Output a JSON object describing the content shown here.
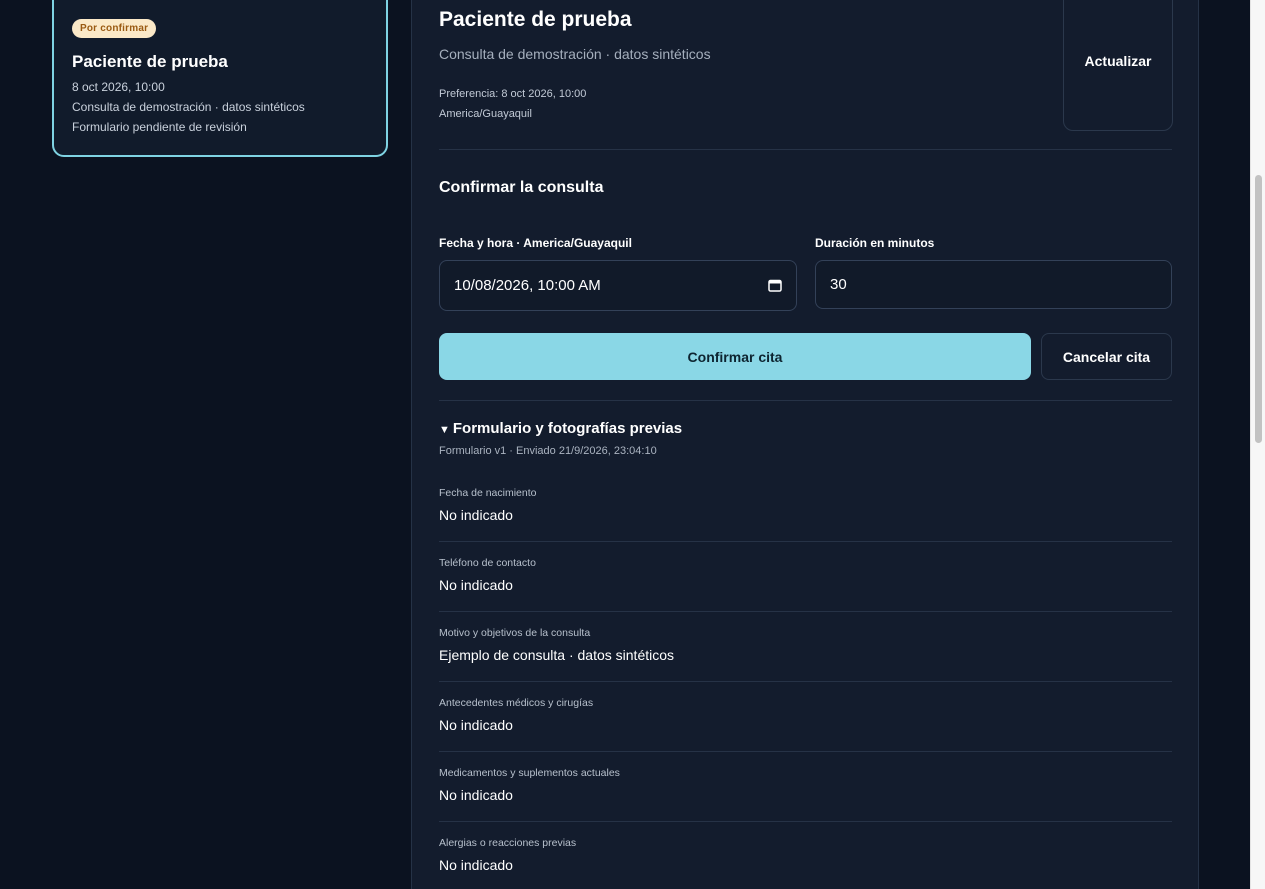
{
  "sidebar_card": {
    "badge": "Por confirmar",
    "name": "Paciente de prueba",
    "datetime": "8 oct 2026, 10:00",
    "service": "Consulta de demostración · datos sintéticos",
    "form_status": "Formulario pendiente de revisión"
  },
  "detail": {
    "patient_name": "Paciente de prueba",
    "service": "Consulta de demostración · datos sintéticos",
    "preference": "Preferencia: 8 oct 2026, 10:00",
    "timezone": "America/Guayaquil",
    "refresh_label": "Actualizar"
  },
  "confirm": {
    "heading": "Confirmar la consulta",
    "datetime_label": "Fecha y hora · America/Guayaquil",
    "datetime_value": "10/08/2026, 10:00 AM",
    "duration_label": "Duración en minutos",
    "duration_value": "30",
    "confirm_label": "Confirmar cita",
    "cancel_label": "Cancelar cita"
  },
  "intake": {
    "summary_marker": "▼",
    "summary_title": "Formulario y fotografías previas",
    "meta": "Formulario v1 · Enviado 21/9/2026, 23:04:10",
    "fields": [
      {
        "question": "Fecha de nacimiento",
        "answer": "No indicado"
      },
      {
        "question": "Teléfono de contacto",
        "answer": "No indicado"
      },
      {
        "question": "Motivo y objetivos de la consulta",
        "answer": "Ejemplo de consulta · datos sintéticos"
      },
      {
        "question": "Antecedentes médicos y cirugías",
        "answer": "No indicado"
      },
      {
        "question": "Medicamentos y suplementos actuales",
        "answer": "No indicado"
      },
      {
        "question": "Alergias o reacciones previas",
        "answer": "No indicado"
      }
    ]
  },
  "colors": {
    "background": "#0b1220",
    "panel": "#131c2d",
    "accent": "#8ad7e6",
    "badge_bg": "#fbe9c8",
    "badge_text": "#9a5a12"
  },
  "icons": {
    "datetime_picker": "calendar-icon",
    "summary_toggle": "triangle-down-icon"
  }
}
